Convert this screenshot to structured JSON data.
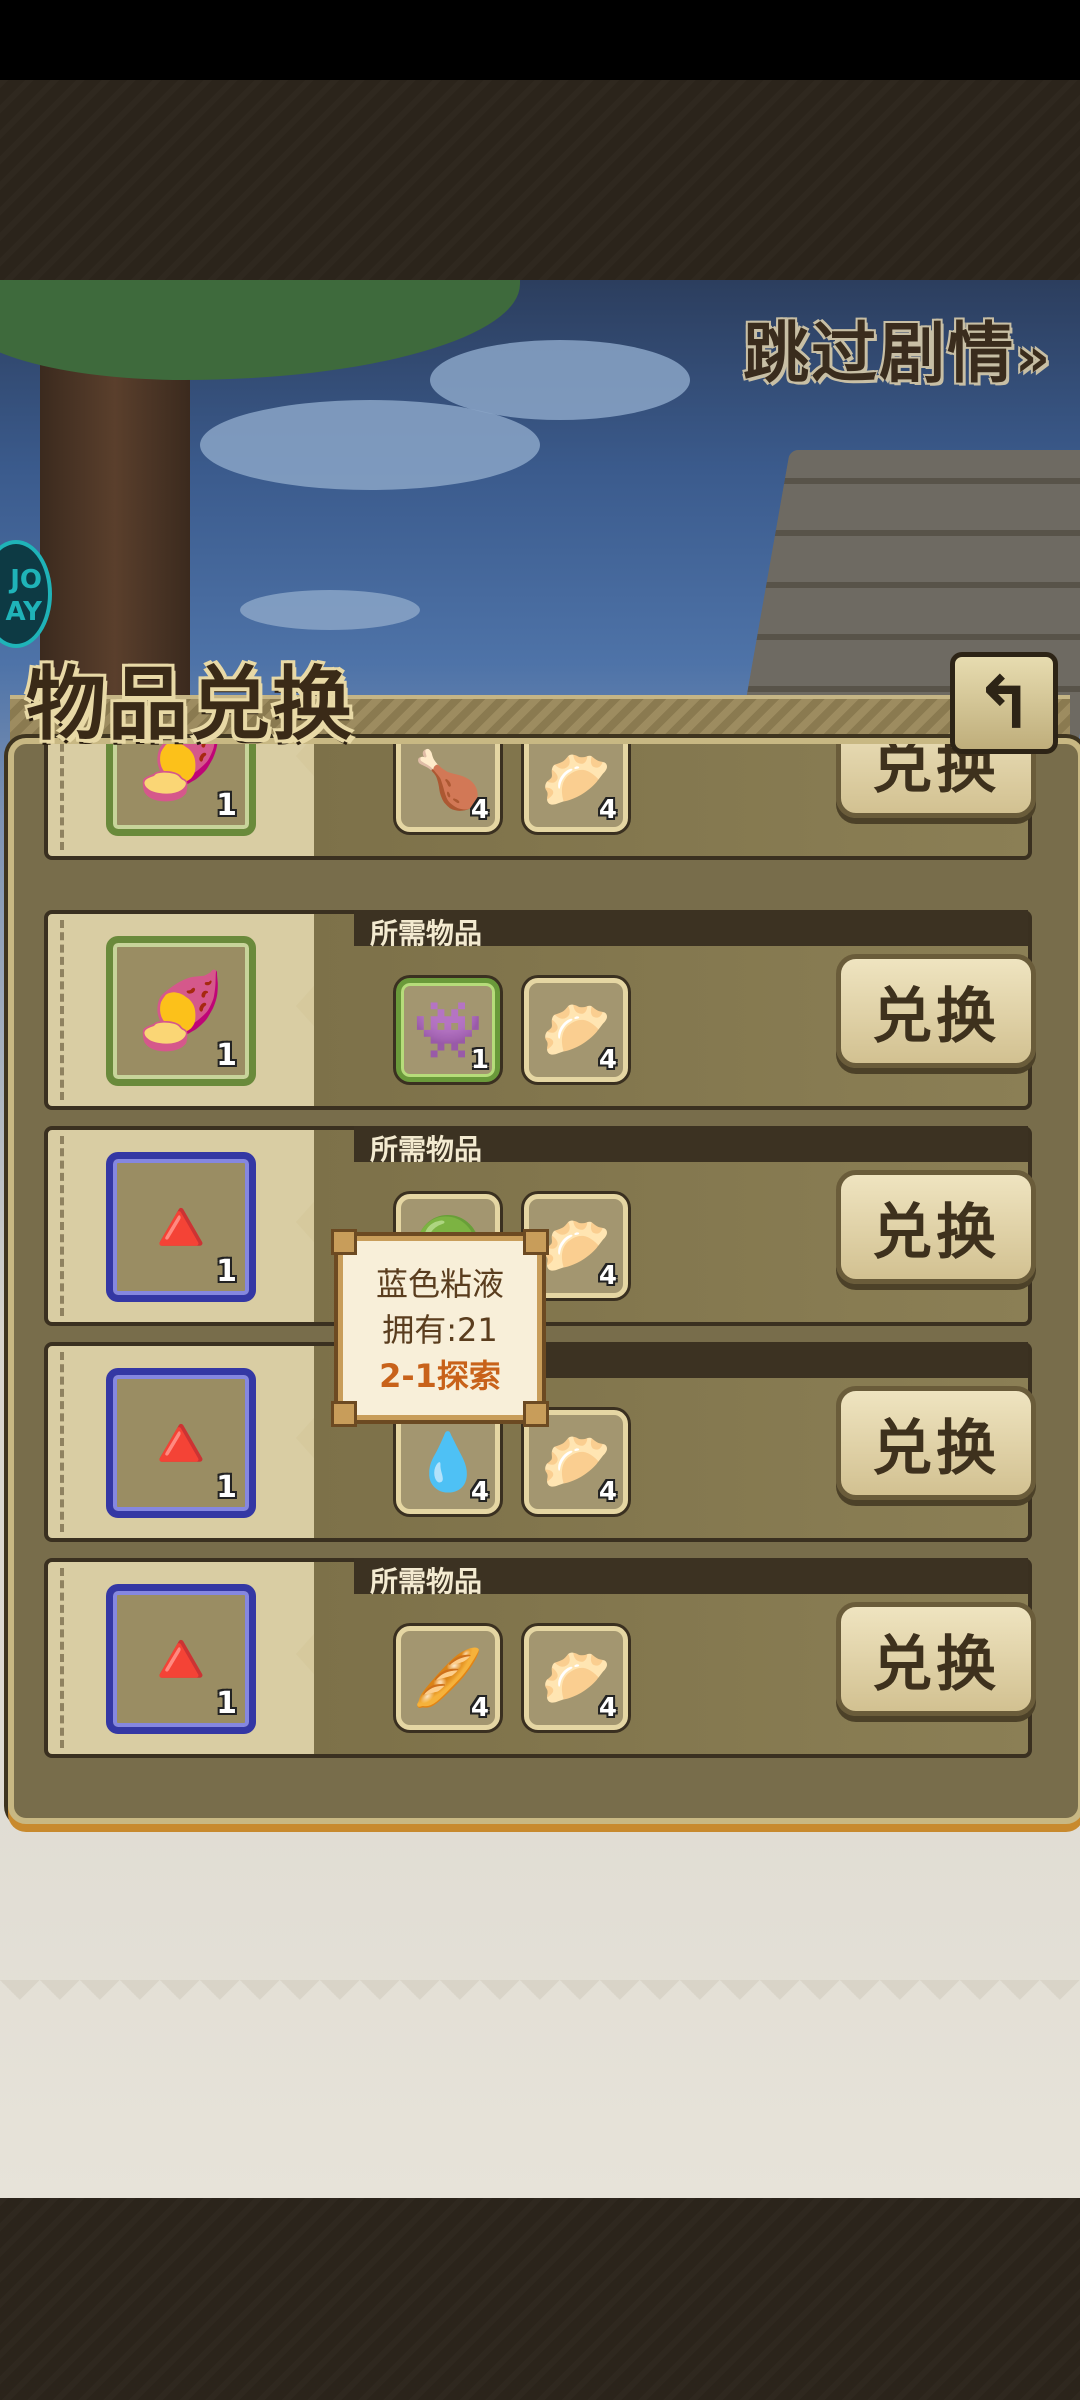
{
  "header": {
    "skip_label": "跳过剧情",
    "skip_icon": "»",
    "logo_text": "JO\nAY"
  },
  "panel": {
    "title": "物品兑换",
    "back_icon": "↰"
  },
  "rows": [
    {
      "reward": {
        "icon": "🍠",
        "count": "1",
        "rarity": "green"
      },
      "required_label": "",
      "required": [
        {
          "icon": "🍗",
          "count": "4",
          "rarity": "normal"
        },
        {
          "icon": "🥟",
          "count": "4",
          "rarity": "normal"
        }
      ],
      "button": "兑换"
    },
    {
      "reward": {
        "icon": "🍠",
        "count": "1",
        "rarity": "green"
      },
      "required_label": "所需物品",
      "required": [
        {
          "icon": "👾",
          "count": "1",
          "rarity": "green"
        },
        {
          "icon": "🥟",
          "count": "4",
          "rarity": "normal"
        }
      ],
      "button": "兑换"
    },
    {
      "reward": {
        "icon": "🔺",
        "count": "1",
        "rarity": "blue"
      },
      "required_label": "所需物品",
      "required": [
        {
          "icon": "🟢",
          "count": "",
          "rarity": "normal"
        },
        {
          "icon": "🥟",
          "count": "4",
          "rarity": "normal"
        }
      ],
      "button": "兑换"
    },
    {
      "reward": {
        "icon": "🔺",
        "count": "1",
        "rarity": "blue"
      },
      "required_label": "",
      "required": [
        {
          "icon": "💧",
          "count": "4",
          "rarity": "normal"
        },
        {
          "icon": "🥟",
          "count": "4",
          "rarity": "normal"
        }
      ],
      "button": "兑换"
    },
    {
      "reward": {
        "icon": "🔺",
        "count": "1",
        "rarity": "blue"
      },
      "required_label": "所需物品",
      "required": [
        {
          "icon": "🥖",
          "count": "4",
          "rarity": "normal"
        },
        {
          "icon": "🥟",
          "count": "4",
          "rarity": "normal"
        }
      ],
      "button": "兑换"
    }
  ],
  "tooltip": {
    "name": "蓝色粘液",
    "owned": "拥有:21",
    "source": "2-1探索"
  },
  "colors": {
    "panel_bg": "#786d4b",
    "green_frame": "#6a8a3b",
    "blue_frame": "#3437a4",
    "accent_orange": "#c8621a"
  }
}
